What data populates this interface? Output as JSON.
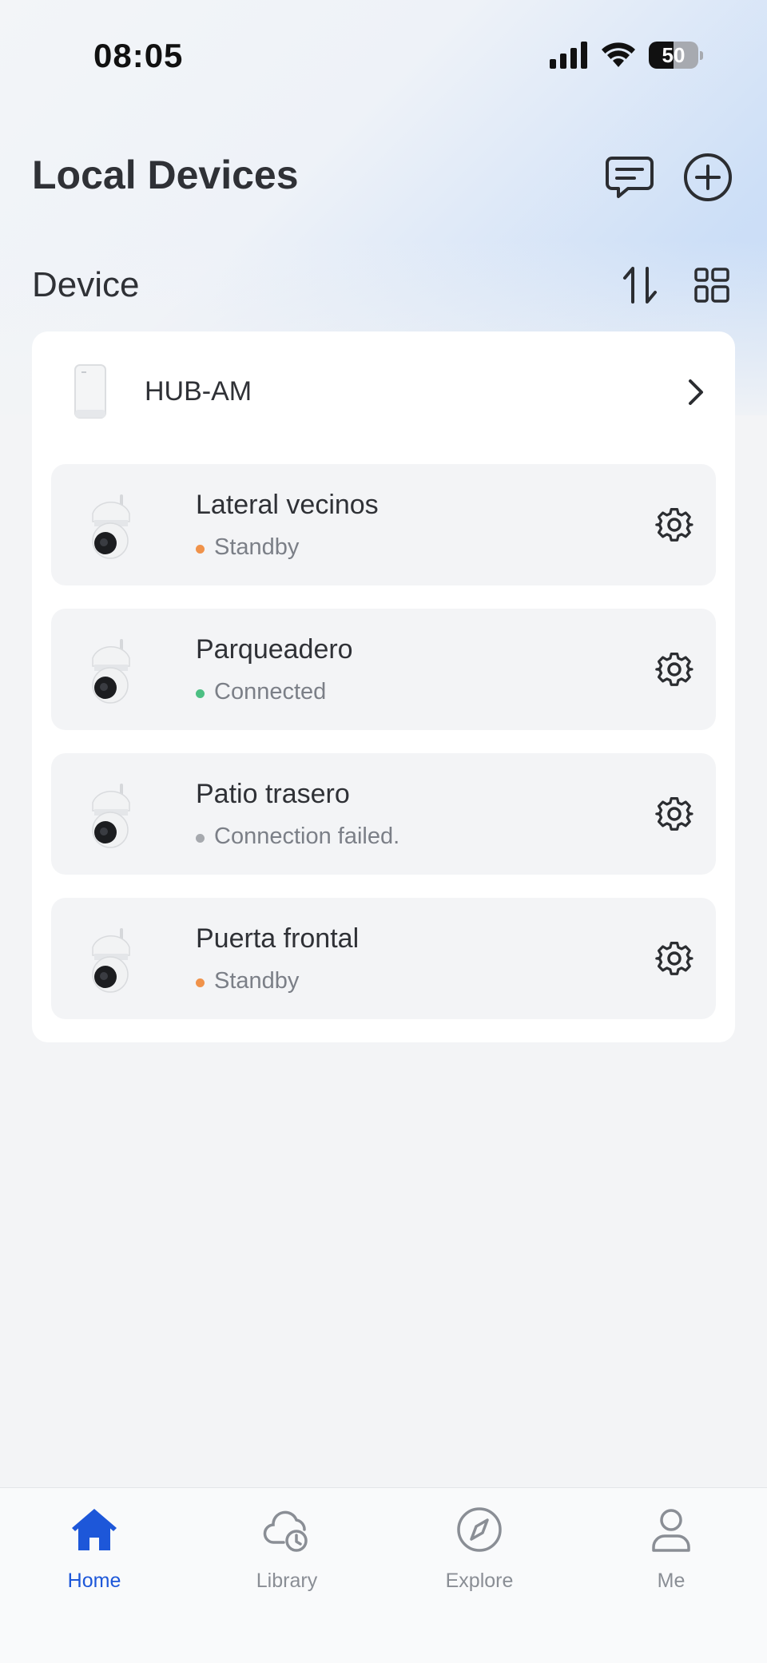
{
  "status_bar": {
    "time": "08:05",
    "battery": "50",
    "battery_level": 0.5
  },
  "header": {
    "title": "Local Devices"
  },
  "section": {
    "title": "Device"
  },
  "hub": {
    "name": "HUB-AM"
  },
  "devices": [
    {
      "name": "Lateral vecinos",
      "status": "Standby",
      "status_color": "#f0924a"
    },
    {
      "name": "Parqueadero",
      "status": "Connected",
      "status_color": "#4cbf83"
    },
    {
      "name": "Patio trasero",
      "status": "Connection failed.",
      "status_color": "#a6a9ae"
    },
    {
      "name": "Puerta frontal",
      "status": "Standby",
      "status_color": "#f0924a"
    }
  ],
  "tabs": [
    {
      "label": "Home",
      "icon": "home-icon",
      "active": true
    },
    {
      "label": "Library",
      "icon": "cloud-clock-icon",
      "active": false
    },
    {
      "label": "Explore",
      "icon": "compass-icon",
      "active": false
    },
    {
      "label": "Me",
      "icon": "user-icon",
      "active": false
    }
  ],
  "colors": {
    "accent": "#1d57d9",
    "text": "#2f3136",
    "muted": "#7b7f87"
  }
}
